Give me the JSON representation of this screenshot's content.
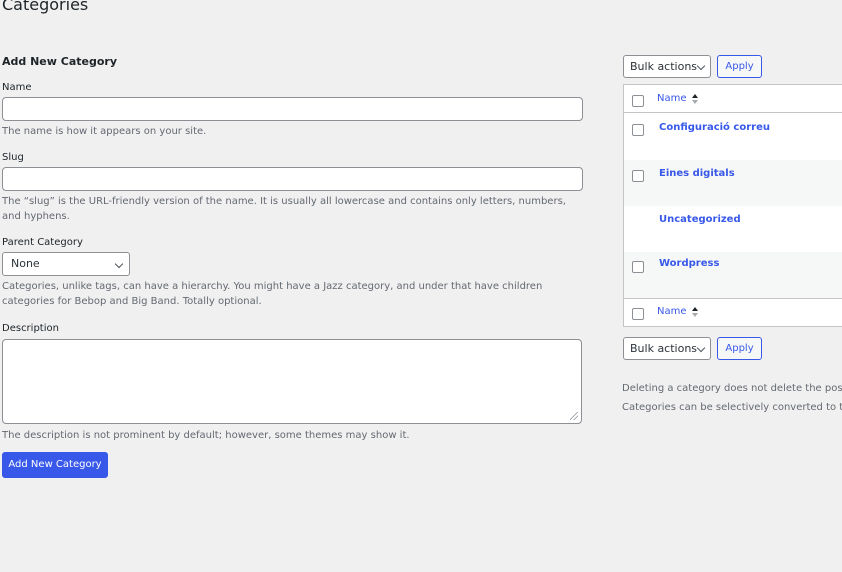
{
  "page": {
    "title": "Categories"
  },
  "form": {
    "heading": "Add New Category",
    "name_label": "Name",
    "name_value": "",
    "name_help": "The name is how it appears on your site.",
    "slug_label": "Slug",
    "slug_value": "",
    "slug_help": "The “slug” is the URL-friendly version of the name. It is usually all lowercase and contains only letters, numbers, and hyphens.",
    "parent_label": "Parent Category",
    "parent_selected": "None",
    "parent_help": "Categories, unlike tags, can have a hierarchy. You might have a Jazz category, and under that have children categories for Bebop and Big Band. Totally optional.",
    "description_label": "Description",
    "description_value": "",
    "description_help": "The description is not prominent by default; however, some themes may show it.",
    "submit_label": "Add New Category"
  },
  "list": {
    "bulk_top": "Bulk actions",
    "apply_top": "Apply",
    "bulk_bottom": "Bulk actions",
    "apply_bottom": "Apply",
    "column_name": "Name",
    "rows": [
      {
        "name": "Configuració correu",
        "checkbox": true
      },
      {
        "name": "Eines digitals",
        "checkbox": true
      },
      {
        "name": "Uncategorized",
        "checkbox": false
      },
      {
        "name": "Wordpress",
        "checkbox": true
      }
    ],
    "note_1": "Deleting a category does not delete the posts i",
    "note_2": "Categories can be selectively converted to tags"
  },
  "colors": {
    "accent": "#3858e9",
    "border": "#8c8f94",
    "background": "#f0f0f1"
  }
}
